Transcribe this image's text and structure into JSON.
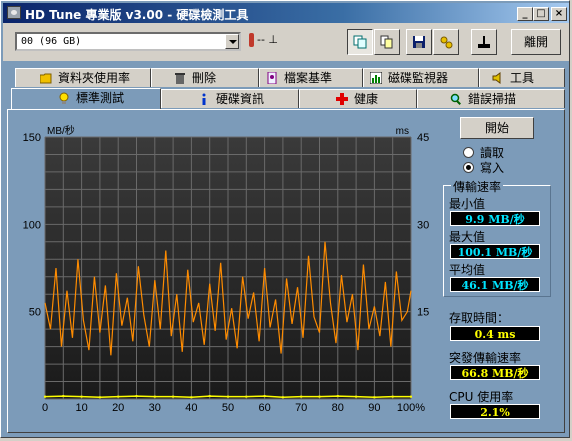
{
  "window": {
    "title": "HD Tune 專業版 v3.00 - 硬碟檢測工具"
  },
  "titlebar_buttons": [
    "_",
    "□",
    "×"
  ],
  "toolbar": {
    "drive_select": "00  (96 GB)",
    "temperature": "-- ⊥",
    "exit_label": "離開",
    "icons": [
      "copy-icon",
      "copy-alt-icon",
      "save-icon",
      "options-icon",
      "exit-joystick-icon"
    ]
  },
  "tabs_top": [
    {
      "label": "資料夾使用率",
      "icon": "folder-icon"
    },
    {
      "label": "刪除",
      "icon": "trash-icon"
    },
    {
      "label": "檔案基準",
      "icon": "file-benchmark-icon"
    },
    {
      "label": "磁碟監視器",
      "icon": "monitor-icon"
    },
    {
      "label": "工具",
      "icon": "speaker-icon"
    }
  ],
  "tabs_bottom": [
    {
      "label": "標準測試",
      "icon": "lightbulb-icon",
      "active": true
    },
    {
      "label": "硬碟資訊",
      "icon": "info-icon"
    },
    {
      "label": "健康",
      "icon": "health-cross-icon"
    },
    {
      "label": "錯誤掃描",
      "icon": "magnifier-icon"
    }
  ],
  "controls": {
    "start_label": "開始",
    "read_label": "讀取",
    "write_label": "寫入",
    "write_selected": true
  },
  "stats": {
    "transfer_rate_title": "傳輸速率",
    "min_label": "最小值",
    "min_value": "9.9 MB/秒",
    "max_label": "最大值",
    "max_value": "100.1 MB/秒",
    "avg_label": "平均值",
    "avg_value": "46.1 MB/秒",
    "access_label": "存取時間：",
    "access_value": "0.4 ms",
    "burst_label": "突發傳輸速率",
    "burst_value": "66.8 MB/秒",
    "cpu_label": "CPU 使用率",
    "cpu_value": "2.1%"
  },
  "chart_data": {
    "type": "line",
    "ylabel_left": "MB/秒",
    "ylabel_right": "ms",
    "yticks_left": [
      "150",
      "100",
      "50"
    ],
    "yticks_right": [
      "45",
      "30",
      "15"
    ],
    "ylim": [
      0,
      150
    ],
    "ylim_right": [
      0,
      45
    ],
    "xlim": [
      0,
      100
    ],
    "xticks": [
      "0",
      "10",
      "20",
      "30",
      "40",
      "50",
      "60",
      "70",
      "80",
      "90",
      "100%"
    ],
    "grid": true,
    "colors": {
      "transfer": "#ff8c00",
      "access": "#ffff00",
      "grid": "#6a6a6a"
    },
    "series": [
      {
        "key": "transfer",
        "x": [
          0,
          1.5,
          3,
          4.5,
          6,
          7.5,
          9,
          10.5,
          12,
          13.5,
          15,
          16.5,
          18,
          19.5,
          21,
          22.5,
          24,
          25.5,
          27,
          28.5,
          30,
          31.5,
          33,
          34.5,
          36,
          37.5,
          39,
          40.5,
          42,
          43.5,
          45,
          46.5,
          48,
          49.5,
          51,
          52.5,
          54,
          55.5,
          57,
          58.5,
          60,
          61.5,
          63,
          64.5,
          66,
          67.5,
          69,
          70.5,
          72,
          73.5,
          75,
          76.5,
          78,
          79.5,
          81,
          82.5,
          84,
          85.5,
          87,
          88.5,
          90,
          91.5,
          93,
          94.5,
          96,
          97.5,
          99,
          100
        ],
        "values": [
          55,
          40,
          75,
          30,
          62,
          35,
          80,
          45,
          28,
          70,
          38,
          65,
          25,
          72,
          42,
          58,
          33,
          76,
          48,
          30,
          68,
          40,
          85,
          36,
          60,
          27,
          74,
          44,
          55,
          31,
          66,
          39,
          78,
          34,
          52,
          29,
          70,
          46,
          61,
          33,
          75,
          41,
          57,
          26,
          69,
          43,
          64,
          35,
          82,
          47,
          38,
          90,
          55,
          32,
          71,
          44,
          60,
          28,
          77,
          40,
          53,
          36,
          67,
          30,
          73,
          45,
          50,
          62
        ]
      },
      {
        "key": "access",
        "x": [
          0,
          5,
          10,
          15,
          20,
          25,
          30,
          35,
          40,
          45,
          50,
          55,
          60,
          65,
          70,
          75,
          80,
          85,
          90,
          95,
          100
        ],
        "values": [
          0.4,
          0.5,
          0.4,
          0.3,
          0.4,
          0.5,
          0.4,
          0.4,
          0.3,
          0.5,
          0.4,
          0.4,
          0.5,
          0.3,
          0.4,
          0.4,
          0.5,
          0.4,
          0.3,
          0.4,
          0.4
        ]
      }
    ]
  }
}
